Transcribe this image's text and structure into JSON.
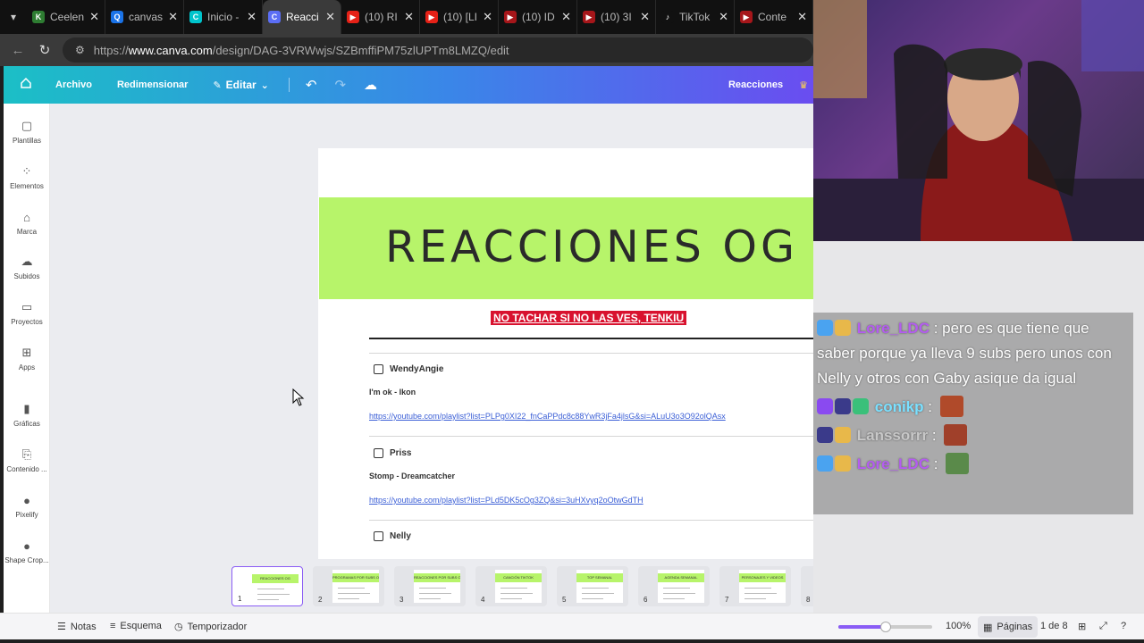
{
  "browser": {
    "tabs": [
      {
        "title": "Ceelen",
        "favicon": "k-icon",
        "color": "#2e7d32",
        "letter": "K"
      },
      {
        "title": "canvas",
        "favicon": "search-icon",
        "color": "#1a73e8",
        "letter": "Q"
      },
      {
        "title": "Inicio -",
        "favicon": "canva-icon",
        "color": "#00c4cc",
        "letter": "C"
      },
      {
        "title": "Reacci",
        "favicon": "canva-doc-icon",
        "color": "#5b6ef5",
        "letter": "C"
      },
      {
        "title": "(10) RI",
        "favicon": "youtube-icon",
        "color": "#e62117",
        "letter": "▶"
      },
      {
        "title": "(10) [LI",
        "favicon": "youtube-icon",
        "color": "#e62117",
        "letter": "▶"
      },
      {
        "title": "(10) ID",
        "favicon": "youtube-icon",
        "color": "#a6161a",
        "letter": "▶"
      },
      {
        "title": "(10) 3I",
        "favicon": "youtube-icon",
        "color": "#a6161a",
        "letter": "▶"
      },
      {
        "title": "TikTok",
        "favicon": "tiktok-icon",
        "color": "#111111",
        "letter": "♪"
      },
      {
        "title": "Conte",
        "favicon": "youtube-studio-icon",
        "color": "#a6161a",
        "letter": "▶"
      }
    ],
    "active_tab_index": 3,
    "url_prefix": "https://",
    "url_host": "www.canva.com",
    "url_path": "/design/DAG-3VRWwjs/SZBmffiPM75zlUPTm8LMZQ/edit"
  },
  "canva_header": {
    "archivo": "Archivo",
    "redimensionar": "Redimensionar",
    "editar": "Editar",
    "project_title": "Reacciones",
    "accent": "#1bbfc6"
  },
  "sidebar": {
    "items": [
      {
        "label": "Plantillas",
        "icon": "templates-icon"
      },
      {
        "label": "Elementos",
        "icon": "elements-icon"
      },
      {
        "label": "Marca",
        "icon": "brand-icon"
      },
      {
        "label": "Subidos",
        "icon": "upload-icon"
      },
      {
        "label": "Proyectos",
        "icon": "folder-icon"
      },
      {
        "label": "Apps",
        "icon": "apps-icon"
      },
      {
        "label": "Gráficas",
        "icon": "chart-icon"
      },
      {
        "label": "Contenido ...",
        "icon": "content-icon"
      },
      {
        "label": "Pixelify",
        "icon": "pixelify-icon"
      },
      {
        "label": "Shape Crop...",
        "icon": "shape-crop-icon"
      }
    ]
  },
  "document": {
    "title": "REACCIONES OG",
    "warning": "NO TACHAR SI NO LAS VES, TENKIU",
    "entries": [
      {
        "name": "WendyAngie",
        "song": "I'm ok - Ikon",
        "link": "https://youtube.com/playlist?list=PLPg0XI22_fnCaPPdc8c88YwR3jFa4jlsG&si=ALuU3o3O92olQAsx"
      },
      {
        "name": "Priss",
        "song": "Stomp - Dreamcatcher",
        "link": "https://youtube.com/playlist?list=PLd5DK5cOg3ZQ&si=3uHXvyq2oOtwGdTH"
      },
      {
        "name": "Nelly",
        "song": "",
        "link": ""
      }
    ]
  },
  "thumbnails": [
    {
      "num": "1",
      "label": "REACCIONES OG"
    },
    {
      "num": "2",
      "label": "PROGRAMAS POR SUBS O NICKS"
    },
    {
      "num": "3",
      "label": "REACCIONES POR SUBS O NICKS"
    },
    {
      "num": "4",
      "label": "CANCIÓN TIKTOK"
    },
    {
      "num": "5",
      "label": "TOP SEMANAL"
    },
    {
      "num": "6",
      "label": "AGENDA SEMANAL"
    },
    {
      "num": "7",
      "label": "PERSONAJES Y VIDEOS"
    },
    {
      "num": "8",
      "label": "OG"
    }
  ],
  "bottombar": {
    "notas": "Notas",
    "esquema": "Esquema",
    "temporizador": "Temporizador",
    "zoom": "100%",
    "zoom_level": 0.5,
    "paginas": "Páginas",
    "page_count": "1 de 8"
  },
  "chat": {
    "messages": [
      {
        "user": "Lore_LDC",
        "color": "#b45cf0",
        "text": "pero es que tiene que saber porque ya lleva 9 subs pero unos con Nelly y otros con Gaby asique da igual"
      },
      {
        "user": "conikp",
        "color": "#7ae0ff",
        "text": ""
      },
      {
        "user": "Lanssorrr",
        "color": "#c8c8c8",
        "text": ""
      },
      {
        "user": "Lore_LDC",
        "color": "#b45cf0",
        "text": ""
      }
    ]
  }
}
